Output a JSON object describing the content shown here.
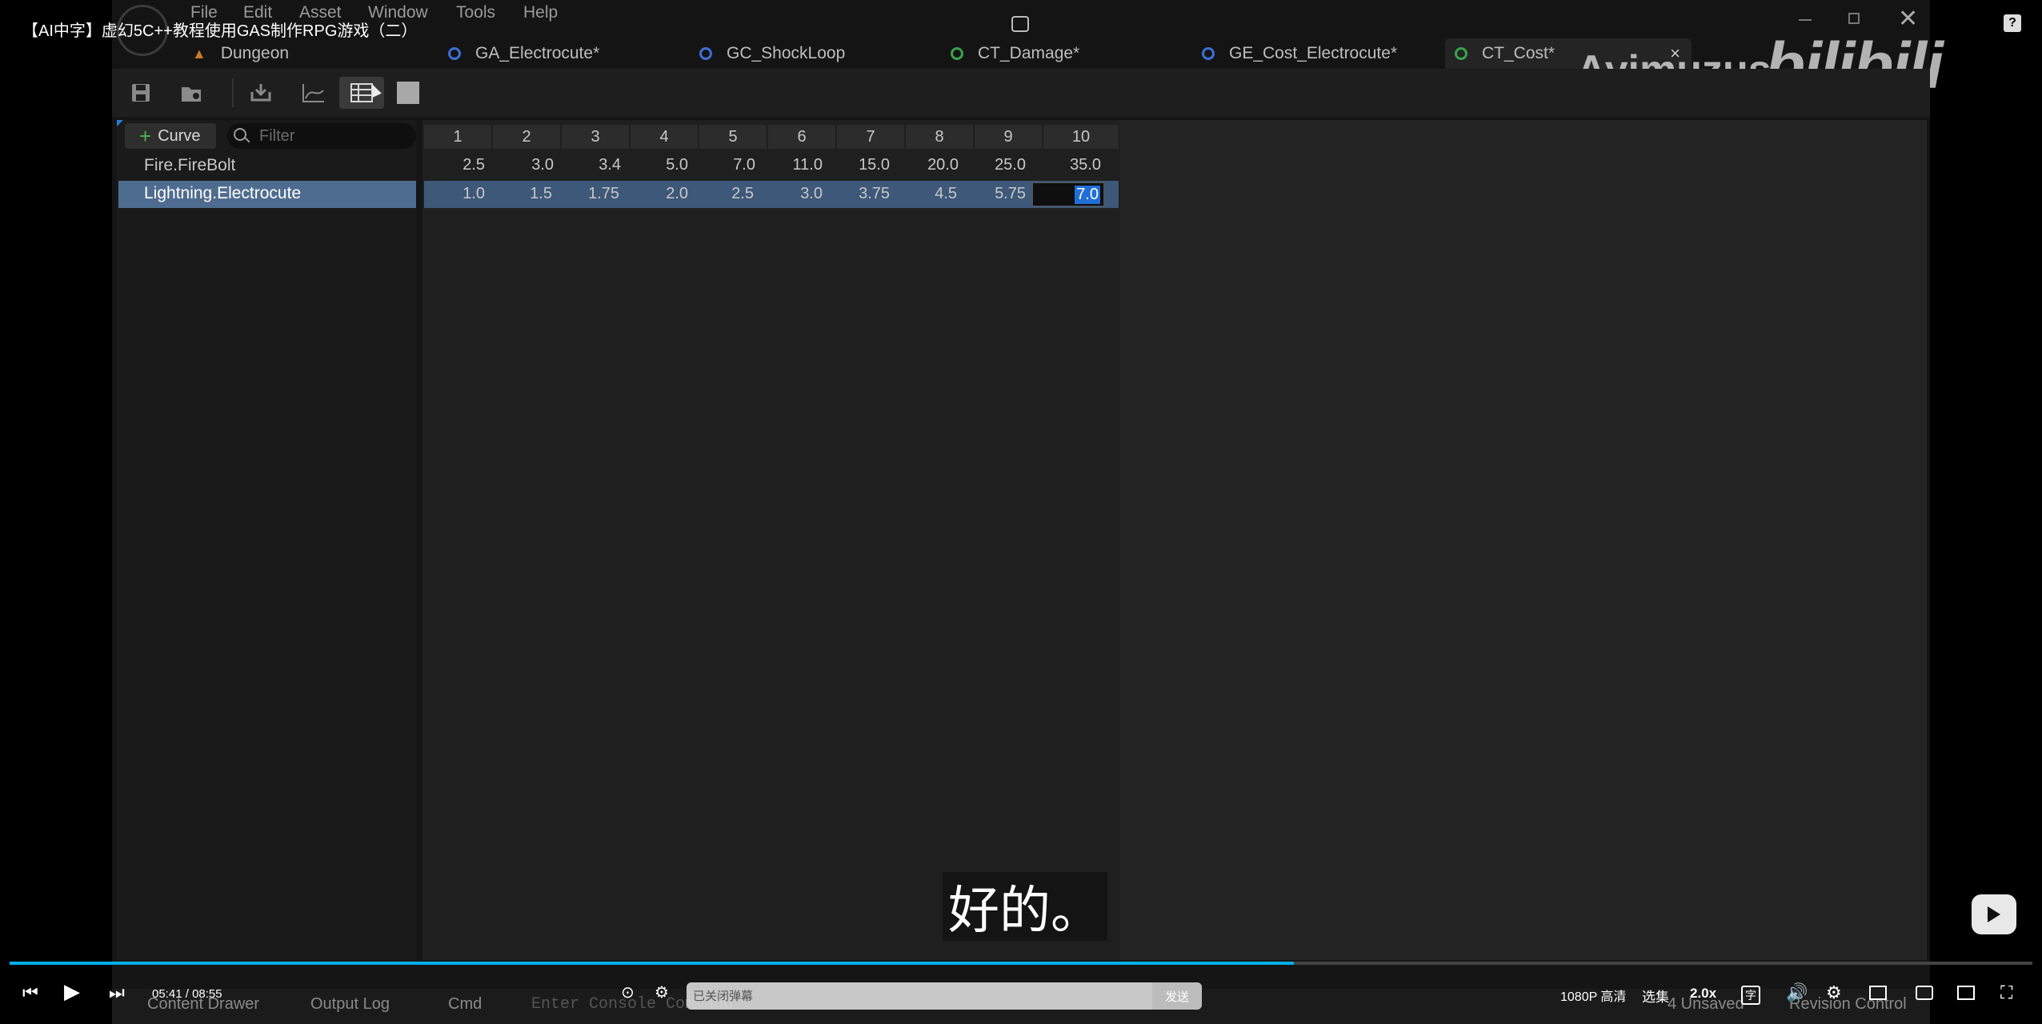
{
  "video": {
    "title": "【AI中字】虚幻5C++教程使用GAS制作RPG游戏（二）",
    "subtitle": "好的。",
    "time_current": "05:41",
    "time_sep": "/",
    "time_total": "08:55",
    "danmaku_placeholder": "已关闭弹幕",
    "send_label": "发送",
    "quality": "1080P 高清",
    "episodes": "选集",
    "speed": "2.0x",
    "watermark_name": "Ayimuzus",
    "watermark_brand": "bilibili",
    "progress_fraction": 0.635
  },
  "menu": [
    "File",
    "Edit",
    "Asset",
    "Window",
    "Tools",
    "Help"
  ],
  "tabs": [
    {
      "label": "Dungeon",
      "color": "#c87a2a"
    },
    {
      "label": "GA_Electrocute*",
      "color": "#3d6fd6"
    },
    {
      "label": "GC_ShockLoop",
      "color": "#3d6fd6"
    },
    {
      "label": "CT_Damage*",
      "color": "#3aa24a"
    },
    {
      "label": "GE_Cost_Electrocute*",
      "color": "#3d6fd6"
    },
    {
      "label": "CT_Cost*",
      "color": "#3aa24a",
      "close": "×"
    }
  ],
  "curve_table": {
    "add_label": "Curve",
    "filter_placeholder": "Filter",
    "columns": [
      "1",
      "2",
      "3",
      "4",
      "5",
      "6",
      "7",
      "8",
      "9",
      "10"
    ],
    "rows": [
      {
        "name": "Fire.FireBolt",
        "values": [
          "2.5",
          "3.0",
          "3.4",
          "5.0",
          "7.0",
          "11.0",
          "15.0",
          "20.0",
          "25.0",
          "35.0"
        ]
      },
      {
        "name": "Lightning.Electrocute",
        "values": [
          "1.0",
          "1.5",
          "1.75",
          "2.0",
          "2.5",
          "3.0",
          "3.75",
          "4.5",
          "5.75",
          "7.0"
        ]
      }
    ]
  },
  "bottom": {
    "content_drawer": "Content Drawer",
    "output_log": "Output Log",
    "cmd": "Cmd",
    "console_placeholder": "Enter Console Command",
    "unsaved": "4 Unsaved",
    "revision": "Revision Control"
  }
}
